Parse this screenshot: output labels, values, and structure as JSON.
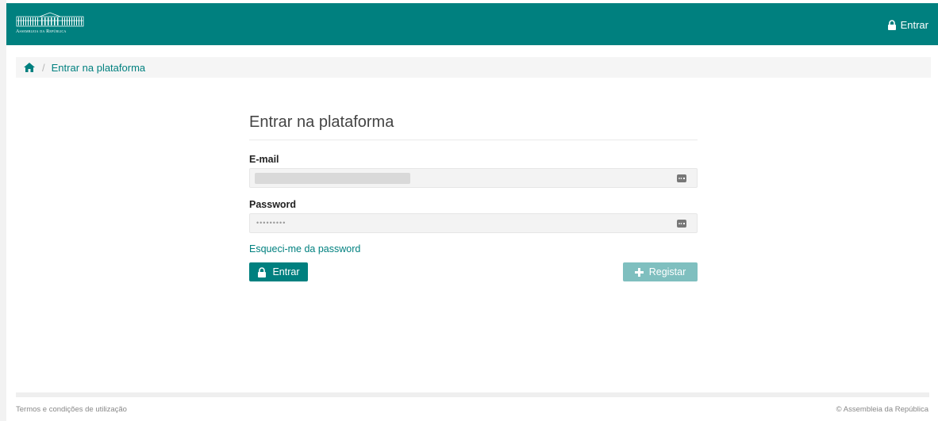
{
  "header": {
    "logo_text": "Assembleia da República",
    "login_label": "Entrar",
    "bg_color": "#00807f"
  },
  "breadcrumb": {
    "home_icon": "home-icon",
    "current": "Entrar na plataforma"
  },
  "login_form": {
    "title": "Entrar na plataforma",
    "email_label": "E-mail",
    "email_value": "",
    "password_label": "Password",
    "password_value": "•••••••••",
    "forgot_link": "Esqueci-me da password",
    "login_button": "Entrar",
    "register_button": "Registar"
  },
  "footer": {
    "terms": "Termos e condições de utilização",
    "copyright": "© Assembleia da República"
  },
  "colors": {
    "accent": "#00807f",
    "accent_light": "#7fbfbf"
  }
}
